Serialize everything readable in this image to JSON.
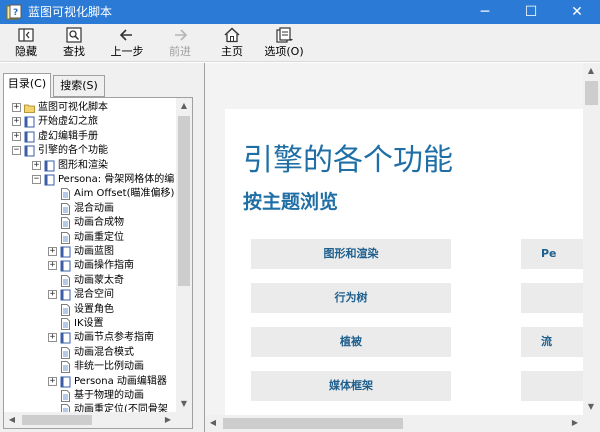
{
  "window": {
    "title": "蓝图可视化脚本",
    "minimize": "─",
    "maximize": "☐",
    "close": "✕"
  },
  "toolbar": {
    "hide": "隐藏",
    "find": "查找",
    "back": "上一步",
    "forward": "前进",
    "home": "主页",
    "options": "选项(O)"
  },
  "tabs": {
    "contents": "目录(C)",
    "search": "搜索(S)"
  },
  "tree": [
    {
      "label": "蓝图可视化脚本",
      "icon": "folder-icon",
      "expander": "+",
      "level": 0
    },
    {
      "label": "开始虚幻之旅",
      "icon": "book-icon",
      "expander": "+",
      "level": 0
    },
    {
      "label": "虚幻编辑手册",
      "icon": "book-icon",
      "expander": "+",
      "level": 0
    },
    {
      "label": "引擎的各个功能",
      "icon": "book-icon",
      "expander": "−",
      "level": 0
    },
    {
      "label": "图形和渲染",
      "icon": "book-icon",
      "expander": "+",
      "level": 1
    },
    {
      "label": "Persona: 骨架网格体的编",
      "icon": "book-icon",
      "expander": "−",
      "level": 1
    },
    {
      "label": "Aim Offset(瞄准偏移)",
      "icon": "page-icon",
      "expander": "",
      "level": 2
    },
    {
      "label": "混合动画",
      "icon": "page-icon",
      "expander": "",
      "level": 2
    },
    {
      "label": "动画合成物",
      "icon": "page-icon",
      "expander": "",
      "level": 2
    },
    {
      "label": "动画重定位",
      "icon": "page-icon",
      "expander": "",
      "level": 2
    },
    {
      "label": "动画蓝图",
      "icon": "book-icon",
      "expander": "+",
      "level": 2
    },
    {
      "label": "动画操作指南",
      "icon": "book-icon",
      "expander": "+",
      "level": 2
    },
    {
      "label": "动画蒙太奇",
      "icon": "page-icon",
      "expander": "",
      "level": 2
    },
    {
      "label": "混合空间",
      "icon": "book-icon",
      "expander": "+",
      "level": 2
    },
    {
      "label": "设置角色",
      "icon": "page-icon",
      "expander": "",
      "level": 2
    },
    {
      "label": "IK设置",
      "icon": "page-icon",
      "expander": "",
      "level": 2
    },
    {
      "label": "动画节点参考指南",
      "icon": "book-icon",
      "expander": "+",
      "level": 2
    },
    {
      "label": "动画混合模式",
      "icon": "page-icon",
      "expander": "",
      "level": 2
    },
    {
      "label": "非统一比例动画",
      "icon": "page-icon",
      "expander": "",
      "level": 2
    },
    {
      "label": "Persona 动画编辑器",
      "icon": "book-icon",
      "expander": "+",
      "level": 2
    },
    {
      "label": "基于物理的动画",
      "icon": "page-icon",
      "expander": "",
      "level": 2
    },
    {
      "label": "动画重定位(不同骨架",
      "icon": "page-icon",
      "expander": "",
      "level": 2
    }
  ],
  "content": {
    "title": "引擎的各个功能",
    "subtitle": "按主题浏览",
    "cards": [
      {
        "left": "图形和渲染",
        "right": "Pe"
      },
      {
        "left": "行为树",
        "right": ""
      },
      {
        "left": "植被",
        "right": "流"
      },
      {
        "left": "媒体框架",
        "right": ""
      }
    ]
  }
}
